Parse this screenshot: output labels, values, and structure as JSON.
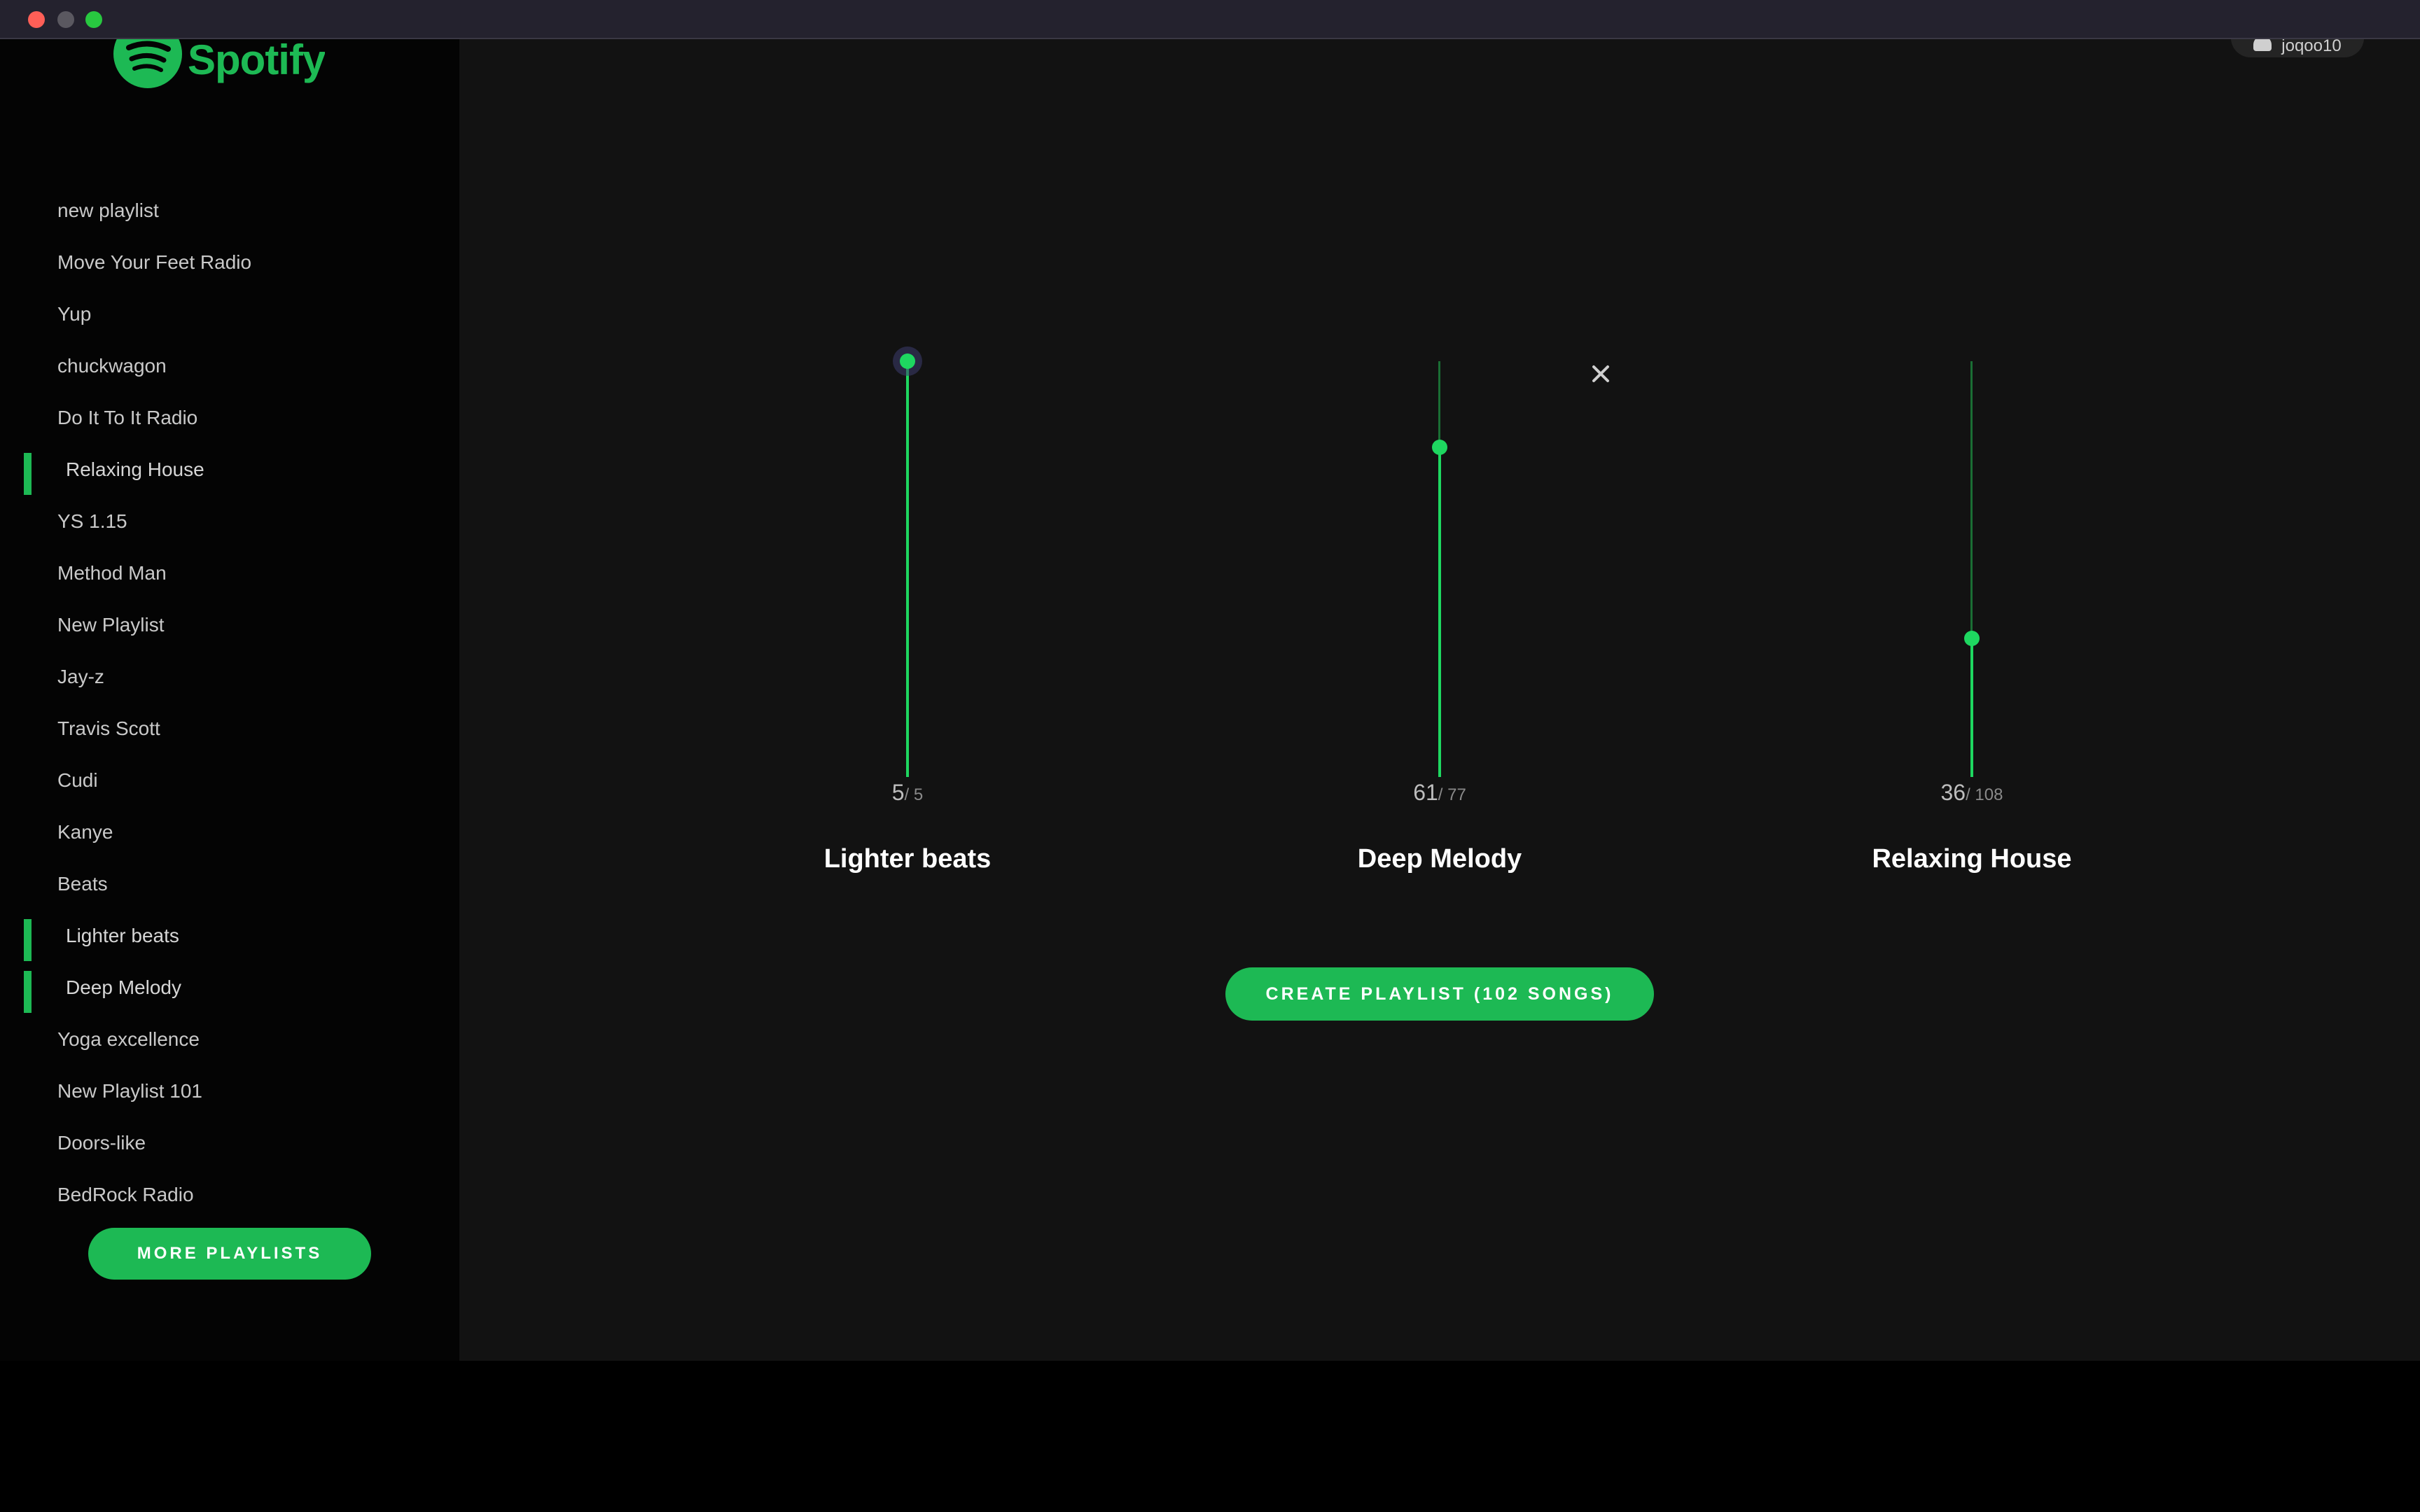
{
  "app": {
    "brand": "Spotify",
    "accent_color": "#1db954",
    "user": {
      "name": "joqoo10"
    }
  },
  "sidebar": {
    "items": [
      {
        "label": "new playlist",
        "selected": false
      },
      {
        "label": "Move Your Feet Radio",
        "selected": false
      },
      {
        "label": "Yup",
        "selected": false
      },
      {
        "label": "chuckwagon",
        "selected": false
      },
      {
        "label": "Do It To It Radio",
        "selected": false
      },
      {
        "label": "Relaxing House",
        "selected": true
      },
      {
        "label": "YS 1.15",
        "selected": false
      },
      {
        "label": "Method Man",
        "selected": false
      },
      {
        "label": "New Playlist",
        "selected": false
      },
      {
        "label": "Jay-z",
        "selected": false
      },
      {
        "label": "Travis Scott",
        "selected": false
      },
      {
        "label": "Cudi",
        "selected": false
      },
      {
        "label": "Kanye",
        "selected": false
      },
      {
        "label": "Beats",
        "selected": false
      },
      {
        "label": "Lighter beats",
        "selected": true
      },
      {
        "label": "Deep Melody",
        "selected": true
      },
      {
        "label": "Yoga excellence",
        "selected": false
      },
      {
        "label": "New Playlist 101",
        "selected": false
      },
      {
        "label": "Doors-like",
        "selected": false
      },
      {
        "label": "BedRock Radio",
        "selected": false
      }
    ],
    "more_button": "MORE PLAYLISTS"
  },
  "mixer": {
    "columns": [
      {
        "title": "Lighter beats",
        "count": "5",
        "total": "/ 5",
        "value": 5,
        "max": 5
      },
      {
        "title": "Deep Melody",
        "count": "61",
        "total": "/ 77",
        "value": 61,
        "max": 77
      },
      {
        "title": "Relaxing House",
        "count": "36",
        "total": "/ 108",
        "value": 36,
        "max": 108
      }
    ],
    "create_button": "CREATE PLAYLIST (102 SONGS)",
    "close_icon": "close-icon"
  }
}
